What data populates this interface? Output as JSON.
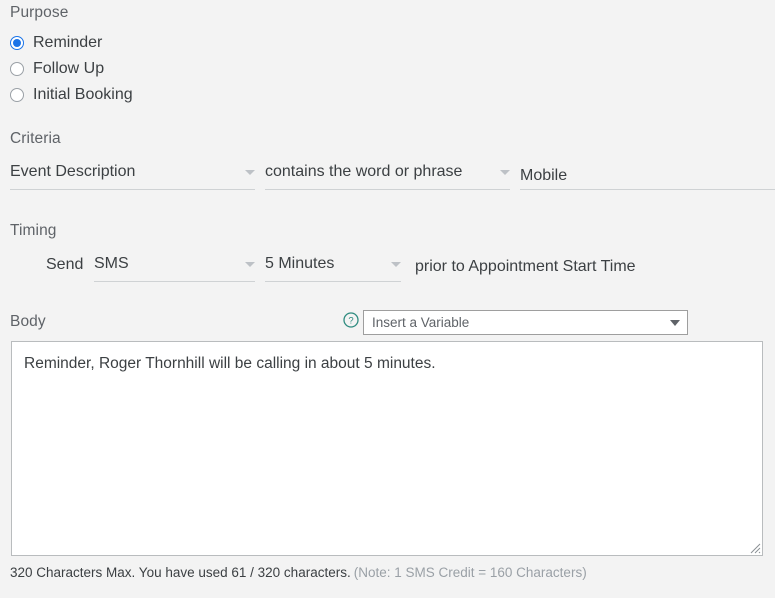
{
  "purpose": {
    "label": "Purpose",
    "options": [
      {
        "label": "Reminder",
        "checked": true
      },
      {
        "label": "Follow Up",
        "checked": false
      },
      {
        "label": "Initial Booking",
        "checked": false
      }
    ]
  },
  "criteria": {
    "label": "Criteria",
    "field_select": "Event Description",
    "operator_select": "contains the word or phrase",
    "value_input": "Mobile",
    "value_placeholder": ""
  },
  "timing": {
    "label": "Timing",
    "send_label": "Send",
    "channel_select": "SMS",
    "offset_select": "5 Minutes",
    "suffix_text": "prior to Appointment Start Time"
  },
  "body": {
    "label": "Body",
    "help_icon": "help-circle-icon",
    "insert_variable": {
      "placeholder": "Insert a Variable",
      "caret_icon": "chevron-down-icon"
    },
    "message": "Reminder, Roger Thornhill will be calling in about 5 minutes.",
    "resize_grip_icon": "resize-handle-icon"
  },
  "footer": {
    "main": "320 Characters Max. You have used 61 / 320 characters.",
    "note": "(Note: 1 SMS Credit = 160 Characters)"
  },
  "colors": {
    "page_background": "#f3f3f3",
    "radio_accent": "#1a73e8",
    "help_icon": "#2e8b7f",
    "label_text": "#5f6368",
    "body_text": "#3c4043",
    "underline": "#cfd2d4",
    "note_text": "#9aa0a6"
  }
}
